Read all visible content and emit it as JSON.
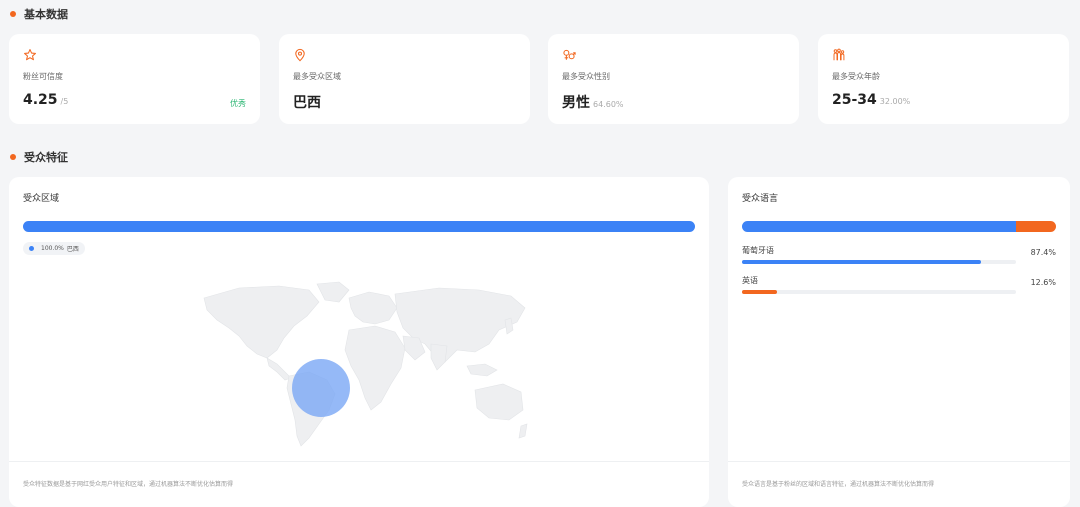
{
  "sections": {
    "basic": "基本数据",
    "audience": "受众特征"
  },
  "stats": [
    {
      "icon": "star-icon",
      "label": "粉丝可信度",
      "value": "4.25",
      "sub": "/5",
      "badge": "优秀"
    },
    {
      "icon": "location-pin-icon",
      "label": "最多受众区域",
      "value": "巴西",
      "sub": "",
      "badge": ""
    },
    {
      "icon": "gender-icon",
      "label": "最多受众性别",
      "value": "男性",
      "sub": "64.60%",
      "badge": ""
    },
    {
      "icon": "people-icon",
      "label": "最多受众年龄",
      "value": "25-34",
      "sub": "32.00%",
      "badge": ""
    }
  ],
  "region_panel": {
    "title": "受众区域",
    "legend_pct": "100.0%",
    "legend_name": "巴西",
    "region_share": 1.0,
    "footnote": "受众特征数据是基于网红受众用户特征和区域，通过机器算法不断优化估算而得"
  },
  "language_panel": {
    "title": "受众语言",
    "languages": [
      {
        "name": "葡萄牙语",
        "pct": "87.4%",
        "share": 0.874,
        "color": "#3b82f6"
      },
      {
        "name": "英语",
        "pct": "12.6%",
        "share": 0.126,
        "color": "#f2671f"
      }
    ],
    "footnote": "受众语言是基于粉丝的区域和语言特征，通过机器算法不断优化估算而得"
  },
  "colors": {
    "accent": "#f2671f",
    "primary": "#3b82f6",
    "good": "#2bb673"
  }
}
